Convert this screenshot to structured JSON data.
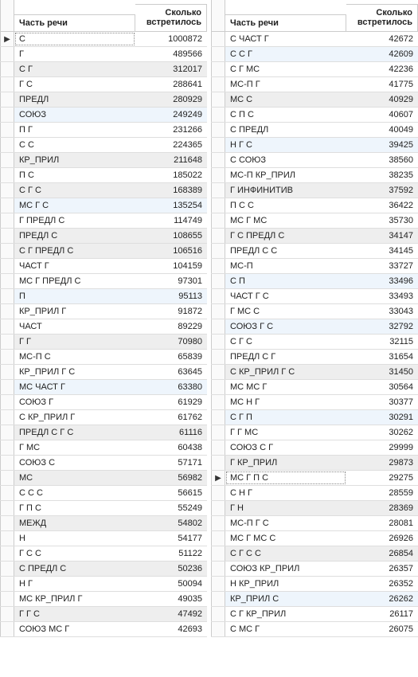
{
  "headers": {
    "col1": "Часть речи",
    "col2_line1": "Сколько",
    "col2_line2": "встретилось"
  },
  "left": {
    "active_row_index": 0,
    "rows": [
      {
        "label": "С",
        "count": 1000872,
        "hl": ""
      },
      {
        "label": "Г",
        "count": 489566,
        "hl": ""
      },
      {
        "label": "С Г",
        "count": 312017,
        "hl": "grey"
      },
      {
        "label": "Г С",
        "count": 288641,
        "hl": ""
      },
      {
        "label": "ПРЕДЛ",
        "count": 280929,
        "hl": "grey"
      },
      {
        "label": "СОЮЗ",
        "count": 249249,
        "hl": "blue"
      },
      {
        "label": "П Г",
        "count": 231266,
        "hl": ""
      },
      {
        "label": "С С",
        "count": 224365,
        "hl": ""
      },
      {
        "label": "КР_ПРИЛ",
        "count": 211648,
        "hl": "grey"
      },
      {
        "label": "П С",
        "count": 185022,
        "hl": ""
      },
      {
        "label": "С Г С",
        "count": 168389,
        "hl": "grey"
      },
      {
        "label": "МС Г С",
        "count": 135254,
        "hl": "blue"
      },
      {
        "label": "Г ПРЕДЛ С",
        "count": 114749,
        "hl": ""
      },
      {
        "label": "ПРЕДЛ С",
        "count": 108655,
        "hl": "grey"
      },
      {
        "label": "С Г ПРЕДЛ С",
        "count": 106516,
        "hl": "grey"
      },
      {
        "label": "ЧАСТ Г",
        "count": 104159,
        "hl": ""
      },
      {
        "label": "МС Г ПРЕДЛ С",
        "count": 97301,
        "hl": ""
      },
      {
        "label": "П",
        "count": 95113,
        "hl": "blue"
      },
      {
        "label": "КР_ПРИЛ Г",
        "count": 91872,
        "hl": ""
      },
      {
        "label": "ЧАСТ",
        "count": 89229,
        "hl": ""
      },
      {
        "label": "Г Г",
        "count": 70980,
        "hl": "grey"
      },
      {
        "label": "МС-П С",
        "count": 65839,
        "hl": ""
      },
      {
        "label": "КР_ПРИЛ Г С",
        "count": 63645,
        "hl": ""
      },
      {
        "label": "МС ЧАСТ Г",
        "count": 63380,
        "hl": "blue"
      },
      {
        "label": "СОЮЗ Г",
        "count": 61929,
        "hl": ""
      },
      {
        "label": "С КР_ПРИЛ Г",
        "count": 61762,
        "hl": ""
      },
      {
        "label": "ПРЕДЛ С Г С",
        "count": 61116,
        "hl": "grey"
      },
      {
        "label": "Г МС",
        "count": 60438,
        "hl": ""
      },
      {
        "label": "СОЮЗ С",
        "count": 57171,
        "hl": ""
      },
      {
        "label": "МС",
        "count": 56982,
        "hl": "grey"
      },
      {
        "label": "С С С",
        "count": 56615,
        "hl": ""
      },
      {
        "label": "Г П С",
        "count": 55249,
        "hl": ""
      },
      {
        "label": "МЕЖД",
        "count": 54802,
        "hl": "grey"
      },
      {
        "label": "Н",
        "count": 54177,
        "hl": ""
      },
      {
        "label": "Г С С",
        "count": 51122,
        "hl": ""
      },
      {
        "label": "С ПРЕДЛ С",
        "count": 50236,
        "hl": "grey"
      },
      {
        "label": "Н Г",
        "count": 50094,
        "hl": ""
      },
      {
        "label": "МС КР_ПРИЛ Г",
        "count": 49035,
        "hl": ""
      },
      {
        "label": "Г Г С",
        "count": 47492,
        "hl": "grey"
      },
      {
        "label": "СОЮЗ МС Г",
        "count": 42693,
        "hl": ""
      }
    ]
  },
  "right": {
    "active_row_index": 29,
    "rows": [
      {
        "label": "С ЧАСТ Г",
        "count": 42672,
        "hl": ""
      },
      {
        "label": "С С Г",
        "count": 42609,
        "hl": "blue"
      },
      {
        "label": "С Г МС",
        "count": 42236,
        "hl": ""
      },
      {
        "label": "МС-П Г",
        "count": 41775,
        "hl": ""
      },
      {
        "label": "МС С",
        "count": 40929,
        "hl": "grey"
      },
      {
        "label": "С П С",
        "count": 40607,
        "hl": ""
      },
      {
        "label": "С ПРЕДЛ",
        "count": 40049,
        "hl": ""
      },
      {
        "label": "Н Г С",
        "count": 39425,
        "hl": "blue"
      },
      {
        "label": "С СОЮЗ",
        "count": 38560,
        "hl": ""
      },
      {
        "label": "МС-П КР_ПРИЛ",
        "count": 38235,
        "hl": ""
      },
      {
        "label": "Г ИНФИНИТИВ",
        "count": 37592,
        "hl": "grey"
      },
      {
        "label": "П С С",
        "count": 36422,
        "hl": ""
      },
      {
        "label": "МС Г МС",
        "count": 35730,
        "hl": ""
      },
      {
        "label": "Г С ПРЕДЛ С",
        "count": 34147,
        "hl": "grey"
      },
      {
        "label": "ПРЕДЛ С С",
        "count": 34145,
        "hl": ""
      },
      {
        "label": "МС-П",
        "count": 33727,
        "hl": ""
      },
      {
        "label": "С П",
        "count": 33496,
        "hl": "blue"
      },
      {
        "label": "ЧАСТ Г С",
        "count": 33493,
        "hl": ""
      },
      {
        "label": "Г МС С",
        "count": 33043,
        "hl": ""
      },
      {
        "label": "СОЮЗ Г С",
        "count": 32792,
        "hl": "blue"
      },
      {
        "label": "С Г С",
        "count": 32115,
        "hl": ""
      },
      {
        "label": "ПРЕДЛ С Г",
        "count": 31654,
        "hl": ""
      },
      {
        "label": "С КР_ПРИЛ Г С",
        "count": 31450,
        "hl": "grey"
      },
      {
        "label": "МС МС Г",
        "count": 30564,
        "hl": ""
      },
      {
        "label": "МС Н Г",
        "count": 30377,
        "hl": ""
      },
      {
        "label": "С Г П",
        "count": 30291,
        "hl": "blue"
      },
      {
        "label": "Г Г МС",
        "count": 30262,
        "hl": ""
      },
      {
        "label": "СОЮЗ С Г",
        "count": 29999,
        "hl": ""
      },
      {
        "label": "Г КР_ПРИЛ",
        "count": 29873,
        "hl": "grey"
      },
      {
        "label": "МС Г П С",
        "count": 29275,
        "hl": ""
      },
      {
        "label": "С Н Г",
        "count": 28559,
        "hl": ""
      },
      {
        "label": "Г Н",
        "count": 28369,
        "hl": "grey"
      },
      {
        "label": "МС-П Г С",
        "count": 28081,
        "hl": ""
      },
      {
        "label": "МС Г МС С",
        "count": 26926,
        "hl": ""
      },
      {
        "label": "С Г С С",
        "count": 26854,
        "hl": "grey"
      },
      {
        "label": "СОЮЗ КР_ПРИЛ",
        "count": 26357,
        "hl": ""
      },
      {
        "label": "Н КР_ПРИЛ",
        "count": 26352,
        "hl": ""
      },
      {
        "label": "КР_ПРИЛ С",
        "count": 26262,
        "hl": "blue"
      },
      {
        "label": "С Г КР_ПРИЛ",
        "count": 26117,
        "hl": ""
      },
      {
        "label": "С МС Г",
        "count": 26075,
        "hl": ""
      }
    ]
  }
}
